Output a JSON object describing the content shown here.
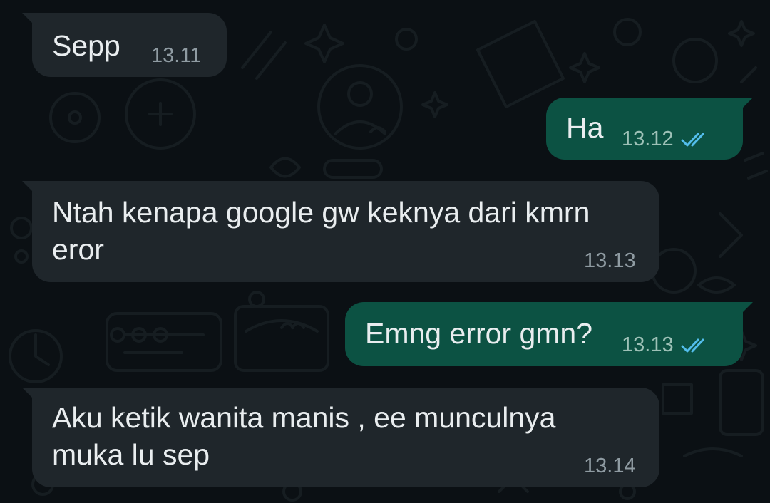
{
  "chat": {
    "messages": [
      {
        "direction": "incoming",
        "lines": [
          "Sepp"
        ],
        "time": "13.11"
      },
      {
        "direction": "outgoing",
        "lines": [
          "Ha"
        ],
        "time": "13.12",
        "status": "read"
      },
      {
        "direction": "incoming",
        "lines": [
          "Ntah kenapa google gw keknya dari kmrn",
          "eror"
        ],
        "time": "13.13"
      },
      {
        "direction": "outgoing",
        "lines": [
          "Emng error gmn?"
        ],
        "time": "13.13",
        "status": "read"
      },
      {
        "direction": "incoming",
        "lines": [
          "Aku ketik wanita manis , ee munculnya",
          "muka lu sep"
        ],
        "time": "13.14"
      }
    ]
  },
  "colors": {
    "background": "#0b1014",
    "incoming_bubble": "#1f262b",
    "outgoing_bubble": "#0c5243",
    "text": "#e9edef",
    "read_ticks": "#53bdeb"
  },
  "icons": {
    "read_receipt": "double-check-icon"
  }
}
